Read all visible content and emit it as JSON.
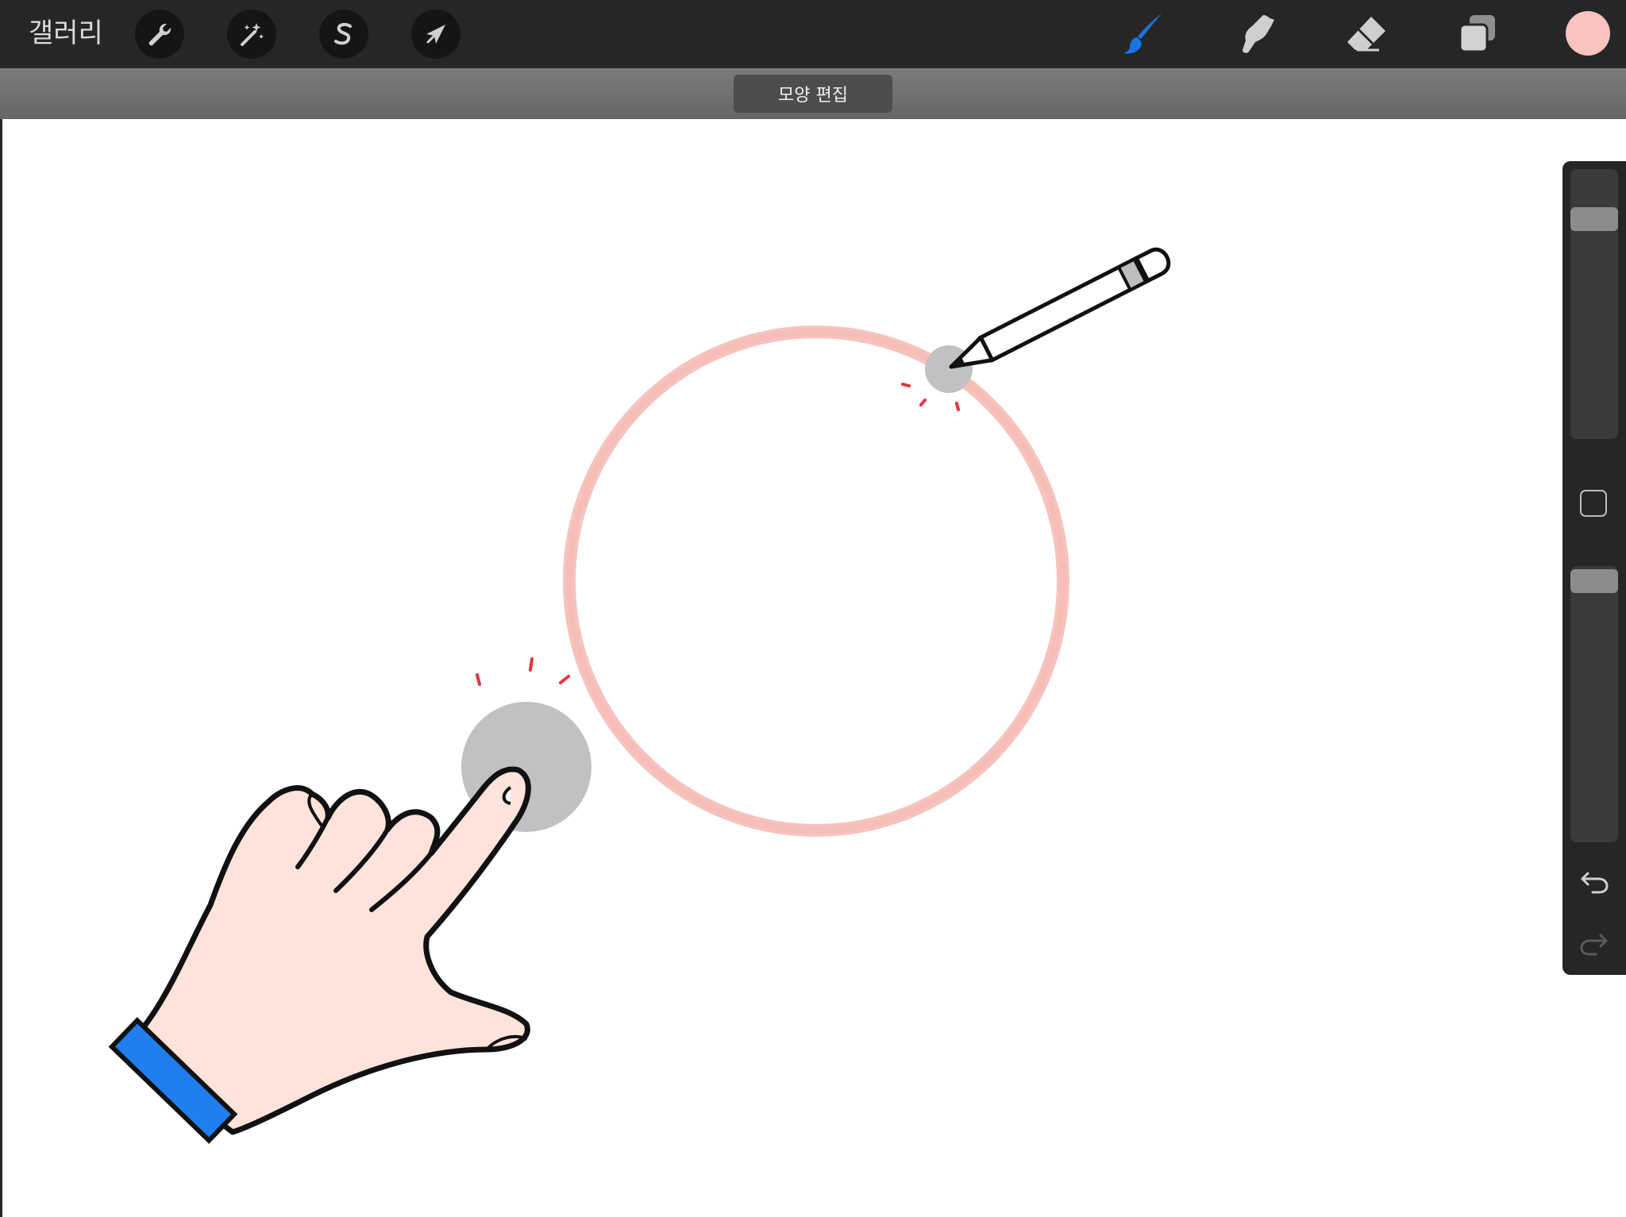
{
  "app": {
    "gallery_label": "갤러리"
  },
  "toolbar": {
    "left_tools": [
      {
        "name": "actions",
        "icon": "wrench-icon"
      },
      {
        "name": "adjustments",
        "icon": "magic-wand-icon"
      },
      {
        "name": "selection",
        "icon": "selection-s-icon"
      },
      {
        "name": "transform",
        "icon": "arrow-cursor-icon"
      }
    ],
    "right_tools": [
      {
        "name": "brush",
        "icon": "brush-icon",
        "active": true
      },
      {
        "name": "smudge",
        "icon": "smudge-icon",
        "active": false
      },
      {
        "name": "eraser",
        "icon": "eraser-icon",
        "active": false
      },
      {
        "name": "layers",
        "icon": "layers-icon",
        "active": false
      }
    ],
    "current_color": "#f9c3bf"
  },
  "mode_bar": {
    "label": "모양 편집"
  },
  "colors": {
    "accent": "#1a73e8",
    "circle_stroke": "#f5b8b3",
    "hand_fill": "#fde3da",
    "sleeve": "#1f7ef0",
    "touch_point": "#c1c1c1",
    "tap_marks": "#e8333c"
  },
  "sidebar": {
    "brush_size_level": 0.05,
    "opacity_level": 0.0
  }
}
